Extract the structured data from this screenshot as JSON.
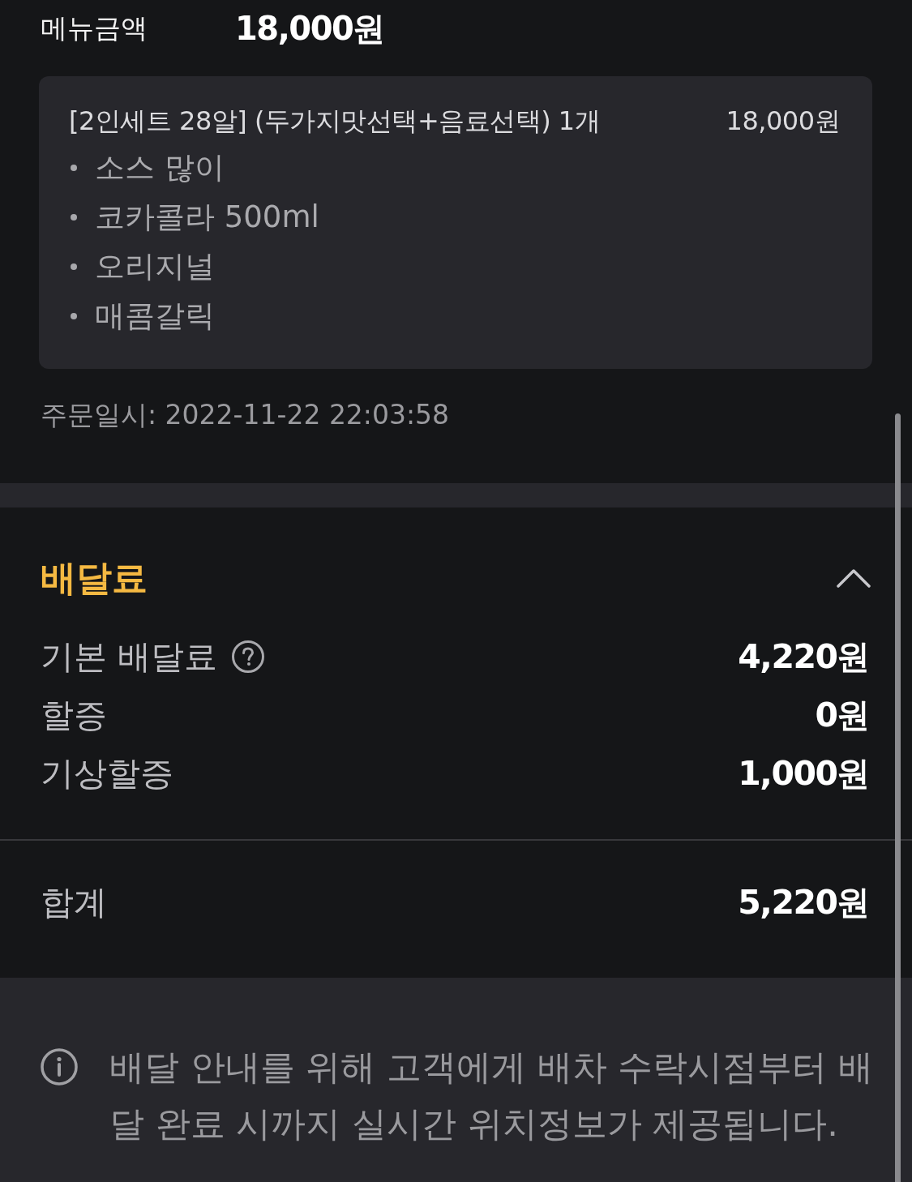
{
  "menu_total": {
    "label": "메뉴금액",
    "value": "18,000원"
  },
  "order_item": {
    "name": "[2인세트 28알] (두가지맛선택+음료선택) 1개",
    "price": "18,000원",
    "options": [
      "소스 많이",
      "코카콜라 500ml",
      "오리지널",
      "매콤갈릭"
    ]
  },
  "order_time": "주문일시: 2022-11-22 22:03:58",
  "delivery_fee": {
    "title": "배달료",
    "expanded": true,
    "rows": [
      {
        "label": "기본 배달료",
        "help": true,
        "value": "4,220원"
      },
      {
        "label": "할증",
        "help": false,
        "value": "0원"
      },
      {
        "label": "기상할증",
        "help": false,
        "value": "1,000원"
      }
    ]
  },
  "total": {
    "label": "합계",
    "value": "5,220원"
  },
  "notice": {
    "text": "배달 안내를 위해 고객에게 배차 수락시점부터 배달 완료 시까지 실시간 위치정보가 제공됩니다."
  }
}
